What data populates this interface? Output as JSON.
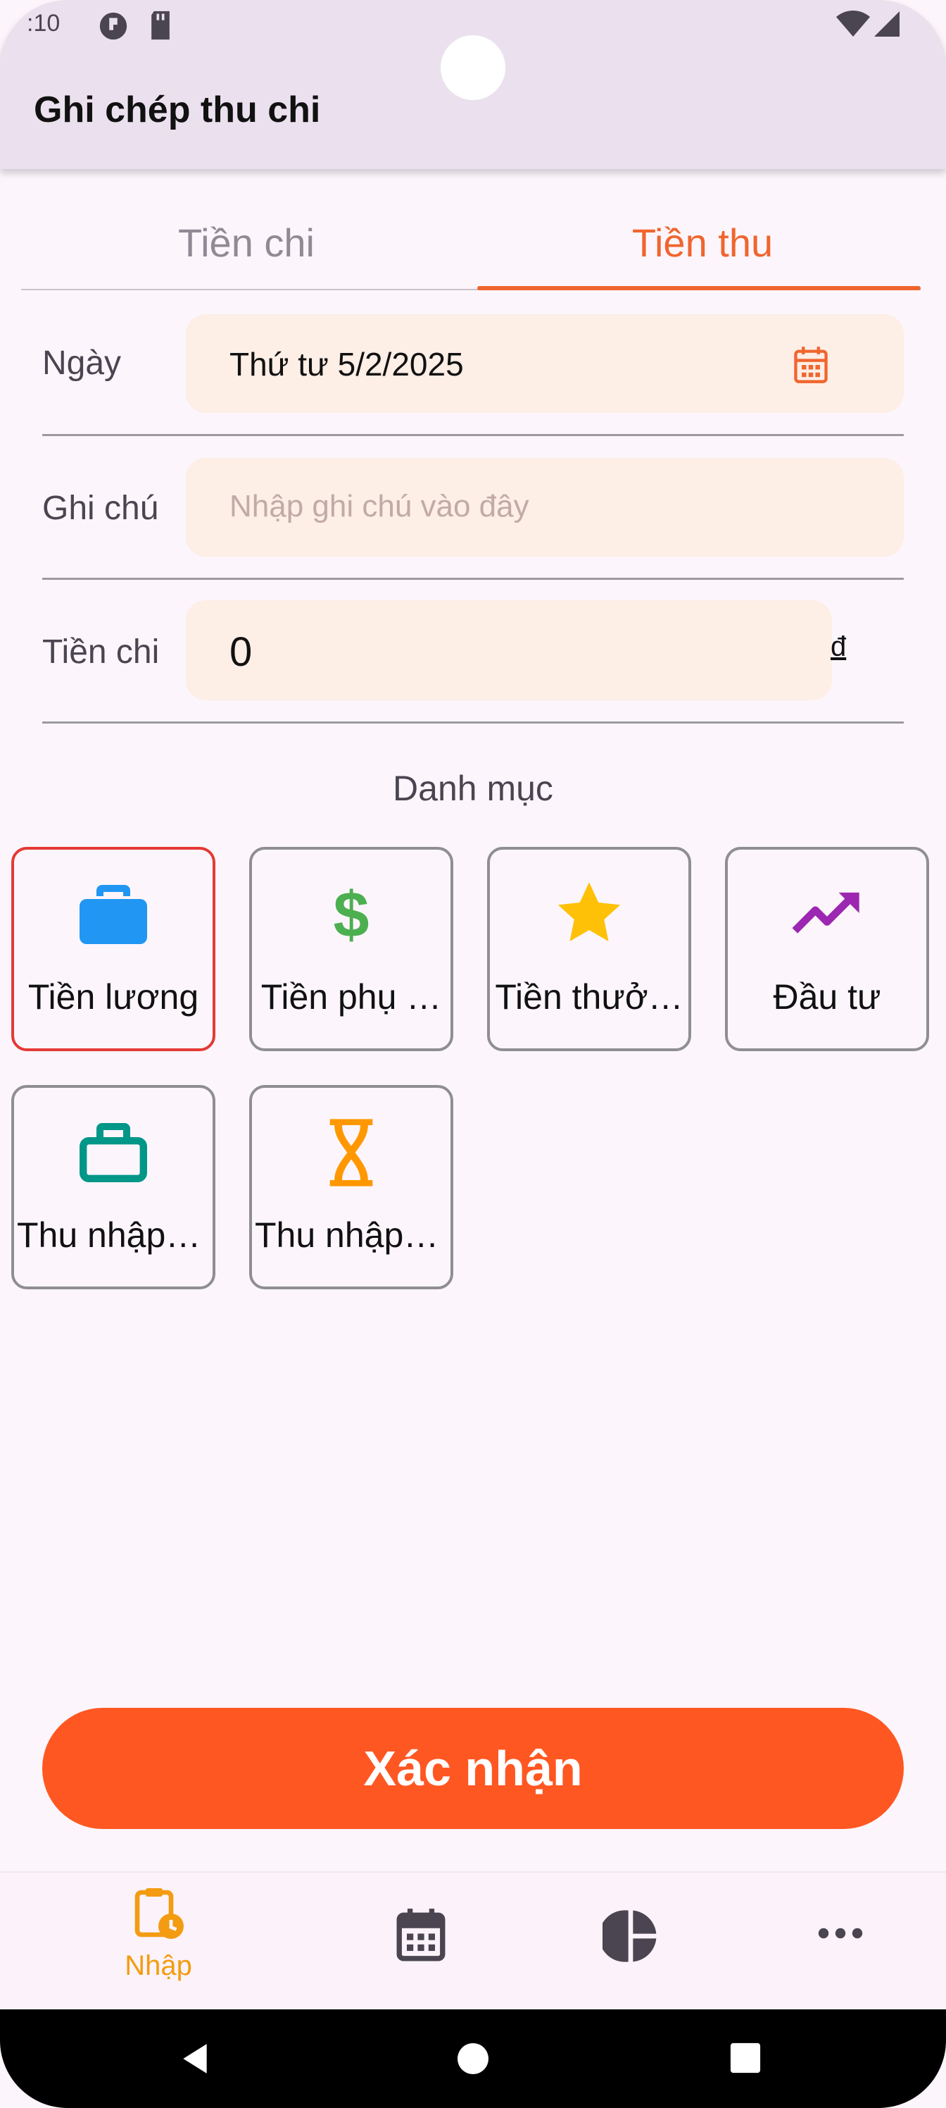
{
  "status_bar": {
    "time": ":10"
  },
  "app_bar": {
    "title": "Ghi chép thu chi"
  },
  "tabs": [
    {
      "label": "Tiền chi",
      "active": false
    },
    {
      "label": "Tiền thu",
      "active": true
    }
  ],
  "form": {
    "date": {
      "label": "Ngày",
      "value": "Thứ tư 5/2/2025"
    },
    "note": {
      "label": "Ghi chú",
      "placeholder": "Nhập ghi chú vào đây",
      "value": ""
    },
    "amount": {
      "label": "Tiền chi",
      "value": "0",
      "currency": "đ"
    }
  },
  "categories": {
    "title": "Danh mục",
    "items": [
      {
        "label": "Tiền lương",
        "icon": "briefcase-icon",
        "color": "#2196f3",
        "selected": true
      },
      {
        "label": "Tiền phụ …",
        "icon": "dollar-icon",
        "color": "#4caf50",
        "selected": false
      },
      {
        "label": "Tiền thưở…",
        "icon": "star-icon",
        "color": "#ffc107",
        "selected": false
      },
      {
        "label": "Đầu tư",
        "icon": "trending-up-icon",
        "color": "#9c27b0",
        "selected": false
      },
      {
        "label": "Thu nhập …",
        "icon": "briefcase-outline-icon",
        "color": "#009688",
        "selected": false
      },
      {
        "label": "Thu nhập …",
        "icon": "hourglass-icon",
        "color": "#ff9800",
        "selected": false
      }
    ]
  },
  "confirm_button": {
    "label": "Xác nhận"
  },
  "bottom_nav": {
    "items": [
      {
        "label": "Nhập",
        "icon": "clipboard-clock-icon",
        "active": true
      },
      {
        "label": "",
        "icon": "calendar-icon",
        "active": false
      },
      {
        "label": "",
        "icon": "pie-chart-icon",
        "active": false
      },
      {
        "label": "",
        "icon": "more-icon",
        "active": false
      }
    ]
  },
  "colors": {
    "accent": "#f0652e",
    "confirm": "#ff5722",
    "field_bg": "#fdeee6",
    "nav_active": "#f39c12"
  }
}
